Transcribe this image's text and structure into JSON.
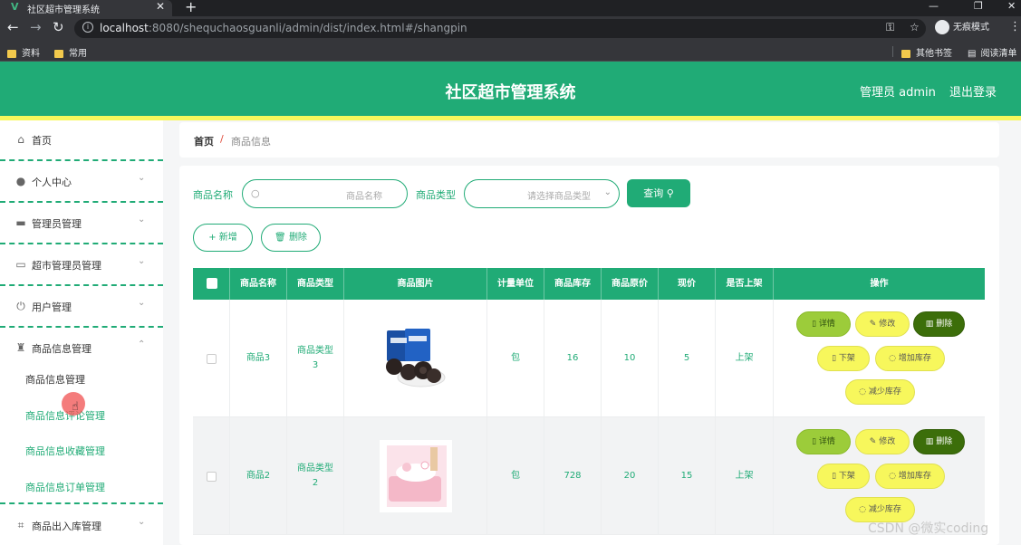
{
  "browser": {
    "tab_title": "社区超市管理系统",
    "url_host": "localhost",
    "url_rest": ":8080/shequchaosguanli/admin/dist/index.html#/shangpin",
    "profile_label": "无痕模式",
    "bookmarks": [
      "资料",
      "常用"
    ],
    "bookmarks_right": [
      "其他书签",
      "阅读清单"
    ]
  },
  "header": {
    "title": "社区超市管理系统",
    "user": "管理员 admin",
    "logout": "退出登录"
  },
  "sidebar": {
    "items": [
      {
        "label": "首页",
        "icon": "home-icon"
      },
      {
        "label": "个人中心",
        "icon": "user-icon"
      },
      {
        "label": "管理员管理",
        "icon": "monitor-icon"
      },
      {
        "label": "超市管理员管理",
        "icon": "id-card-icon"
      },
      {
        "label": "用户管理",
        "icon": "power-icon"
      },
      {
        "label": "商品信息管理",
        "icon": "stamp-icon"
      }
    ],
    "sub_items": [
      {
        "label": "商品信息管理"
      },
      {
        "label": "商品信息评论管理"
      },
      {
        "label": "商品信息收藏管理"
      },
      {
        "label": "商品信息订单管理"
      }
    ],
    "last_item": {
      "label": "商品出入库管理",
      "icon": "crop-icon"
    }
  },
  "breadcrumb": {
    "home": "首页",
    "separator": "/",
    "current": "商品信息"
  },
  "filters": {
    "name_label": "商品名称",
    "name_placeholder": "商品名称",
    "type_label": "商品类型",
    "type_placeholder": "请选择商品类型",
    "query_label": "查询"
  },
  "toolbar": {
    "add_label": "新增",
    "delete_label": "删除"
  },
  "table": {
    "columns": [
      "商品名称",
      "商品类型",
      "商品图片",
      "计量单位",
      "商品库存",
      "商品原价",
      "现价",
      "是否上架",
      "操作"
    ],
    "rows": [
      {
        "name": "商品3",
        "type": "商品类型3",
        "unit": "包",
        "stock": "16",
        "orig_price": "10",
        "price": "5",
        "on_sale": "上架"
      },
      {
        "name": "商品2",
        "type": "商品类型2",
        "unit": "包",
        "stock": "728",
        "orig_price": "20",
        "price": "15",
        "on_sale": "上架"
      }
    ],
    "actions": {
      "detail": "详情",
      "edit": "修改",
      "delete": "删除",
      "offshelf": "下架",
      "add_stock": "增加库存",
      "reduce_stock": "减少库存"
    }
  },
  "watermark": "CSDN @微实coding",
  "colors": {
    "primary": "#20ab76",
    "accent_yellow": "#f7f75c",
    "detail_green": "#9ccc3a",
    "delete_dark": "#3c6e0a"
  }
}
